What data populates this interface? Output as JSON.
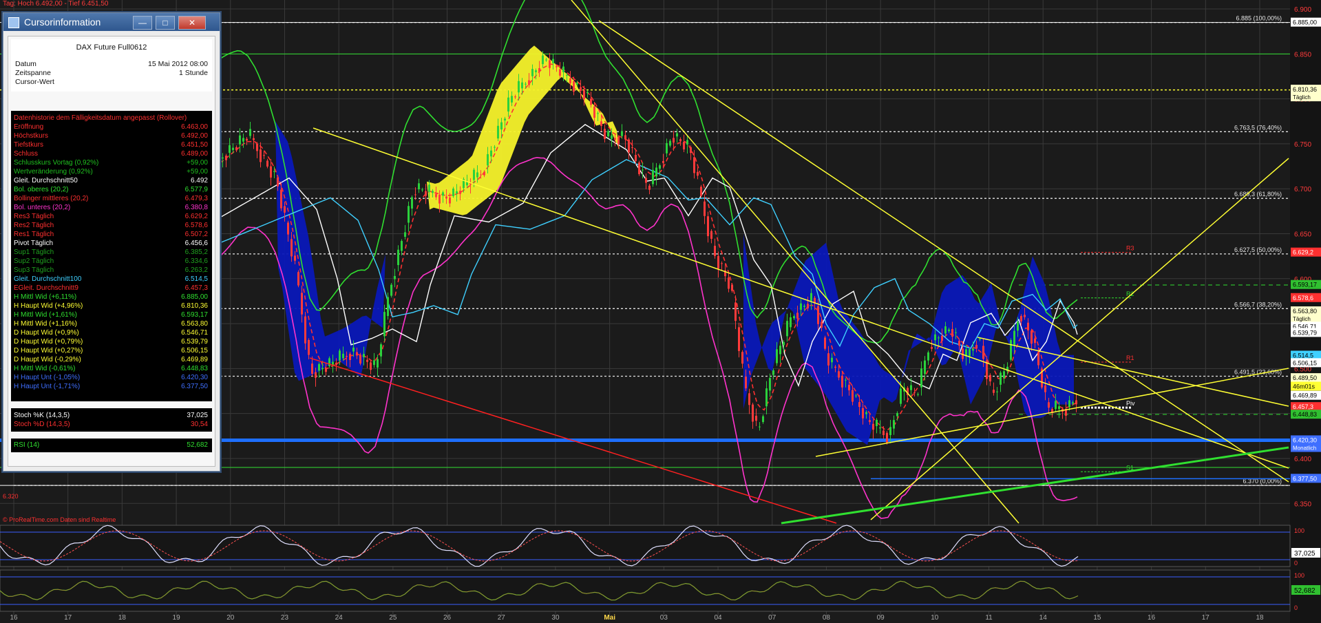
{
  "header": {
    "text": "Tag: Hoch 6.492,00 - Tief 6.451,50",
    "color": "#ff3b3b"
  },
  "credit": {
    "text": "© ProRealTime.com  Daten sind Realtime"
  },
  "left_price_label": "6.320",
  "cursor_window": {
    "title": "Cursorinformation",
    "buttons": {
      "minimize": "—",
      "maximize": "□",
      "close": "✕"
    },
    "product": "DAX Future Full0612",
    "info": [
      {
        "label": "Datum",
        "value": "15 Mai 2012 08:00"
      },
      {
        "label": "Zeitspanne",
        "value": "1 Stunde"
      },
      {
        "label": "Cursor-Wert",
        "value": ""
      }
    ],
    "rows": [
      {
        "label": "Datenhistorie dem Fälligkeitsdatum angepasst (Rollover)",
        "value": "",
        "color": "#ff3030"
      },
      {
        "label": "Eröffnung",
        "value": "6.463,00",
        "color": "#ff3030"
      },
      {
        "label": "Höchstkurs",
        "value": "6.492,00",
        "color": "#ff3030"
      },
      {
        "label": "Tiefstkurs",
        "value": "6.451,50",
        "color": "#ff3030"
      },
      {
        "label": "Schluss",
        "value": "6.489,00",
        "color": "#ff3030"
      },
      {
        "label": "Schlusskurs Vortag (0,92%)",
        "value": "+59,00",
        "color": "#1fc01f"
      },
      {
        "label": "Wertveränderung (0,92%)",
        "value": "+59,00",
        "color": "#1fc01f"
      },
      {
        "label": "Gleit. Durchschnitt50",
        "value": "6.492",
        "color": "#ffffff"
      },
      {
        "label": "Bol. oberes (20,2)",
        "value": "6.577,9",
        "color": "#30e030"
      },
      {
        "label": "Bollinger mittleres (20,2)",
        "value": "6.479,3",
        "color": "#ff3030"
      },
      {
        "label": "Bol. unteres (20,2)",
        "value": "6.380,8",
        "color": "#ff33cc"
      },
      {
        "label": "Res3 Täglich",
        "value": "6.629,2",
        "color": "#ff3030"
      },
      {
        "label": "Res2 Täglich",
        "value": "6.578,6",
        "color": "#ff3030"
      },
      {
        "label": "Res1 Täglich",
        "value": "6.507,2",
        "color": "#ff3030"
      },
      {
        "label": "Pivot Täglich",
        "value": "6.456,6",
        "color": "#ffffff"
      },
      {
        "label": "Sup1 Täglich",
        "value": "6.385,2",
        "color": "#1fa01f"
      },
      {
        "label": "Sup2 Täglich",
        "value": "6.334,6",
        "color": "#1fa01f"
      },
      {
        "label": "Sup3 Täglich",
        "value": "6.263,2",
        "color": "#1fa01f"
      },
      {
        "label": "Gleit. Durchschnitt100",
        "value": "6.514,5",
        "color": "#3fd0ff"
      },
      {
        "label": "EGleit. Durchschnitt9",
        "value": "6.457,3",
        "color": "#ff3030"
      },
      {
        "label": "H Mittl Wid (+6,11%)",
        "value": "6.885,00",
        "color": "#30e030"
      },
      {
        "label": "H Haupt Wid (+4,96%)",
        "value": "6.810,36",
        "color": "#ffff33"
      },
      {
        "label": "H Mittl Wid (+1,61%)",
        "value": "6.593,17",
        "color": "#30e030"
      },
      {
        "label": "H Mittl Wid (+1,16%)",
        "value": "6.563,80",
        "color": "#ffff33"
      },
      {
        "label": "D Haupt Wid (+0,9%)",
        "value": "6.546,71",
        "color": "#ffff33"
      },
      {
        "label": "D Haupt Wid (+0,79%)",
        "value": "6.539,79",
        "color": "#ffff33"
      },
      {
        "label": "D Haupt Wid (+0,27%)",
        "value": "6.506,15",
        "color": "#ffff33"
      },
      {
        "label": "D Haupt Wid (-0,29%)",
        "value": "6.469,89",
        "color": "#ffff33"
      },
      {
        "label": "H Mittl Wid (-0,61%)",
        "value": "6.448,83",
        "color": "#30e030"
      },
      {
        "label": "H Haupt Unt (-1,05%)",
        "value": "6.420,30",
        "color": "#3f6fff"
      },
      {
        "label": "H Haupt Unt (-1,71%)",
        "value": "6.377,50",
        "color": "#3f6fff"
      }
    ],
    "stoch": [
      {
        "label": "Stoch %K (14,3,5)",
        "value": "37,025",
        "color": "#ffffff"
      },
      {
        "label": "Stoch %D (14,3,5)",
        "value": "30,54",
        "color": "#ff3030"
      }
    ],
    "rsi": {
      "label": "RSI (14)",
      "value": "52,682",
      "color": "#30e030"
    }
  },
  "price_axis": {
    "ticks": [
      "6.900",
      "6.850",
      "6.800",
      "6.750",
      "6.700",
      "6.650",
      "6.600",
      "6.550",
      "6.500",
      "6.450",
      "6.400",
      "6.350"
    ],
    "tick_values": [
      6900,
      6850,
      6800,
      6750,
      6700,
      6650,
      6600,
      6550,
      6500,
      6450,
      6400,
      6350
    ],
    "min": 6328,
    "max": 6910,
    "labels": [
      {
        "value": 6885.0,
        "text": "6.885,00",
        "bg": "#ffffff",
        "fg": "#000"
      },
      {
        "value": 6810.36,
        "text": "6.810,36",
        "bg": "#ffffcc",
        "fg": "#000",
        "sub": "Täglich"
      },
      {
        "value": 6629.2,
        "text": "6.629,2",
        "bg": "#ff3030",
        "fg": "#fff"
      },
      {
        "value": 6593.17,
        "text": "6.593,17",
        "bg": "#30c030",
        "fg": "#000"
      },
      {
        "value": 6578.6,
        "text": "6.578,6",
        "bg": "#ff3030",
        "fg": "#fff"
      },
      {
        "value": 6563.8,
        "text": "6.563,80",
        "bg": "#ffffcc",
        "fg": "#000",
        "sub": "Täglich"
      },
      {
        "value": 6546.71,
        "text": "6.546,71",
        "bg": "#ffffff",
        "fg": "#000"
      },
      {
        "value": 6539.79,
        "text": "6.539,79",
        "bg": "#ffffff",
        "fg": "#000"
      },
      {
        "value": 6514.5,
        "text": "6.514,5",
        "bg": "#3fd0ff",
        "fg": "#000"
      },
      {
        "value": 6506.15,
        "text": "6.506,15",
        "bg": "#ffffff",
        "fg": "#000"
      },
      {
        "value": 6489.5,
        "text": "6.489,50",
        "bg": "#ffffcc",
        "fg": "#000"
      },
      {
        "value": 6480,
        "text": "46m01s",
        "bg": "#ffff33",
        "fg": "#000"
      },
      {
        "value": 6469.89,
        "text": "6.469,89",
        "bg": "#ffffff",
        "fg": "#000"
      },
      {
        "value": 6457.3,
        "text": "6.457,3",
        "bg": "#ff3030",
        "fg": "#fff"
      },
      {
        "value": 6448.83,
        "text": "6.448,83",
        "bg": "#30c030",
        "fg": "#000"
      },
      {
        "value": 6420.3,
        "text": "6.420,30",
        "bg": "#3f6fff",
        "fg": "#fff",
        "sub": "Monatlich"
      },
      {
        "value": 6377.5,
        "text": "6.377,50",
        "bg": "#3f6fff",
        "fg": "#fff"
      }
    ]
  },
  "fib_levels": [
    {
      "value": 6885,
      "text": "6.885 (100,00%)"
    },
    {
      "value": 6763.5,
      "text": "6.763,5 (76,40%)"
    },
    {
      "value": 6689.3,
      "text": "6.689,3 (61,80%)"
    },
    {
      "value": 6627.5,
      "text": "6.627,5 (50,00%)"
    },
    {
      "value": 6566.7,
      "text": "6.566,7 (38,20%)"
    },
    {
      "value": 6491.5,
      "text": "6.491,5 (23,60%)"
    },
    {
      "value": 6370,
      "text": "6.370 (0,00%)"
    }
  ],
  "pivot_labels": [
    "R3",
    "R2",
    "R1",
    "Piv",
    "S1"
  ],
  "x_axis": {
    "labels": [
      "16",
      "17",
      "18",
      "19",
      "20",
      "23",
      "24",
      "25",
      "26",
      "27",
      "30",
      "Mai",
      "03",
      "04",
      "07",
      "08",
      "09",
      "10",
      "11",
      "14",
      "15",
      "16",
      "17",
      "18"
    ],
    "highlight": "Mai"
  },
  "stoch_panel": {
    "axis": [
      "100",
      "0"
    ],
    "value": "37,025"
  },
  "rsi_panel": {
    "axis": [
      "100",
      "0"
    ],
    "value": "52,682"
  },
  "colors": {
    "bg": "#1b1b1b",
    "grid": "#3a3a3a",
    "bull": "#2bd13c",
    "bear": "#ff3b3b",
    "boll_upper": "#30e030",
    "boll_lower": "#ff33cc",
    "ma50": "#ffffff",
    "ma100": "#3fd0ff",
    "cloud_blue": "#0a18b8",
    "cloud_yellow": "#f6f22a",
    "support_blue": "#1e6fff"
  }
}
